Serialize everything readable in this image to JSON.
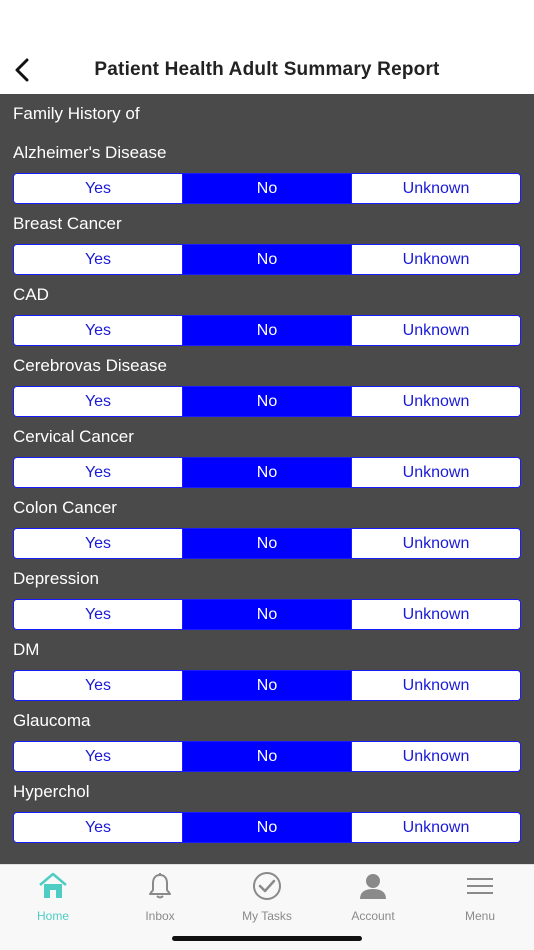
{
  "header": {
    "title": "Patient Health Adult Summary Report"
  },
  "form": {
    "section_heading": "Family History of",
    "options": [
      "Yes",
      "No",
      "Unknown"
    ],
    "questions": [
      {
        "label": "Alzheimer's Disease",
        "selected": "No"
      },
      {
        "label": "Breast Cancer",
        "selected": "No"
      },
      {
        "label": "CAD",
        "selected": "No"
      },
      {
        "label": "Cerebrovas Disease",
        "selected": "No"
      },
      {
        "label": "Cervical Cancer",
        "selected": "No"
      },
      {
        "label": "Colon Cancer",
        "selected": "No"
      },
      {
        "label": "Depression",
        "selected": "No"
      },
      {
        "label": "DM",
        "selected": "No"
      },
      {
        "label": "Glaucoma",
        "selected": "No"
      },
      {
        "label": "Hyperchol",
        "selected": "No"
      }
    ]
  },
  "tabbar": {
    "tabs": [
      {
        "label": "Home",
        "icon": "home-icon",
        "active": true
      },
      {
        "label": "Inbox",
        "icon": "bell-icon",
        "active": false
      },
      {
        "label": "My Tasks",
        "icon": "check-circle-icon",
        "active": false
      },
      {
        "label": "Account",
        "icon": "person-icon",
        "active": false
      },
      {
        "label": "Menu",
        "icon": "hamburger-menu-icon",
        "active": false
      }
    ]
  },
  "colors": {
    "content_bg": "#4a4a4a",
    "segment_selected": "#0000ff",
    "segment_border": "#1a1aff",
    "tab_active": "#4ecdc4",
    "tab_inactive": "#8a8a8a"
  }
}
